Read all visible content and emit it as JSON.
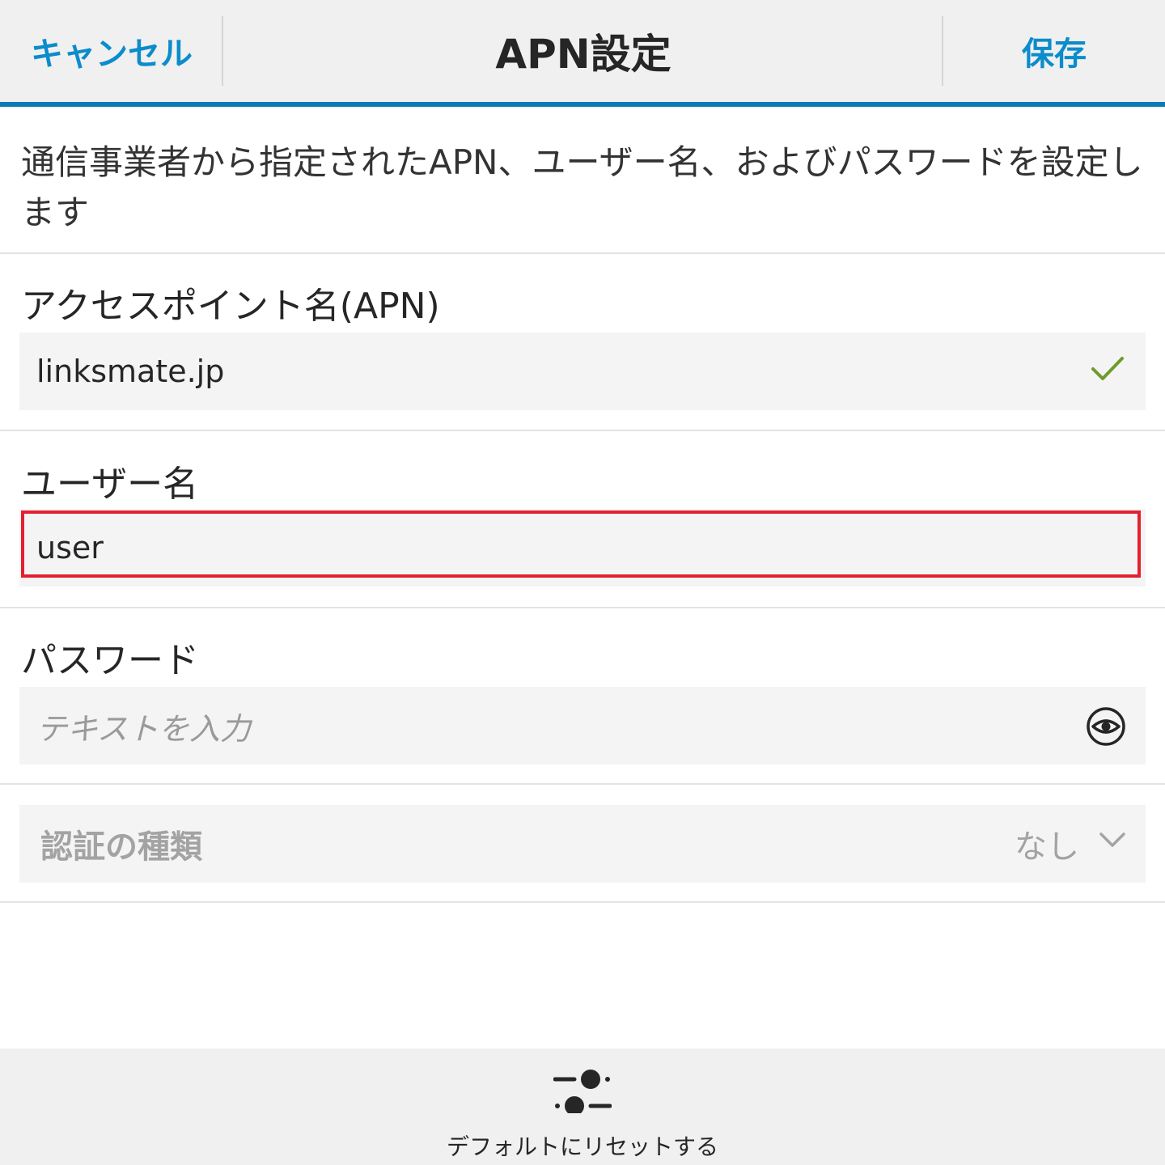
{
  "titlebar": {
    "cancel_label": "キャンセル",
    "title": "APN設定",
    "save_label": "保存",
    "accent_color": "#0a7bb5",
    "action_color": "#0b8ccb"
  },
  "description": "通信事業者から指定されたAPN、ユーザー名、およびパスワードを設定します",
  "apn": {
    "label": "アクセスポイント名(APN)",
    "value": "linksmate.jp",
    "status_icon": "check-icon"
  },
  "username": {
    "label": "ユーザー名",
    "value": "user",
    "highlight_color": "#e3202f"
  },
  "password": {
    "label": "パスワード",
    "placeholder": "テキストを入力",
    "toggle_icon": "eye-icon"
  },
  "auth_type": {
    "label": "認証の種類",
    "selected": "なし",
    "icon": "chevron-down-icon"
  },
  "actionbar": {
    "reset_label": "デフォルトにリセットする",
    "reset_icon": "sliders-icon"
  }
}
